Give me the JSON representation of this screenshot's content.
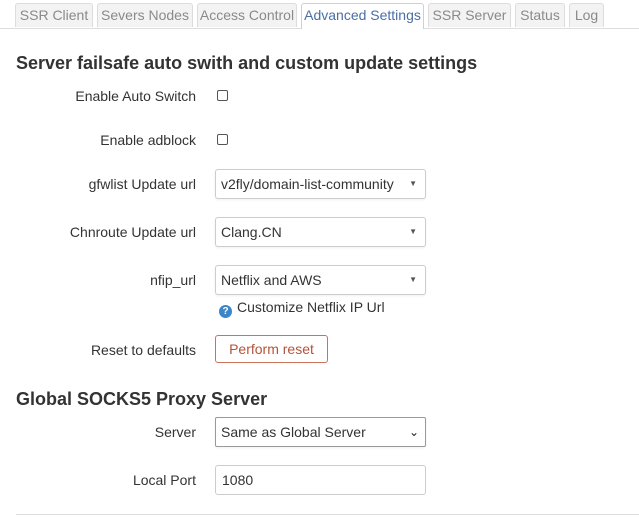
{
  "tabs": [
    {
      "label": "SSR Client"
    },
    {
      "label": "Severs Nodes"
    },
    {
      "label": "Access Control"
    },
    {
      "label": "Advanced Settings",
      "active": true
    },
    {
      "label": "SSR Server"
    },
    {
      "label": "Status"
    },
    {
      "label": "Log"
    }
  ],
  "failsafe": {
    "title": "Server failsafe auto swith and custom update settings",
    "auto_switch_label": "Enable Auto Switch",
    "adblock_label": "Enable adblock",
    "gfwlist_label": "gfwlist Update url",
    "gfwlist_value": "v2fly/domain-list-community",
    "chnroute_label": "Chnroute Update url",
    "chnroute_value": "Clang.CN",
    "nfip_label": "nfip_url",
    "nfip_value": "Netflix and AWS",
    "nfip_help": "Customize Netflix IP Url",
    "reset_label": "Reset to defaults",
    "reset_button": "Perform reset"
  },
  "socks": {
    "title": "Global SOCKS5 Proxy Server",
    "server_label": "Server",
    "server_value": "Same as Global Server",
    "port_label": "Local Port",
    "port_value": "1080"
  },
  "icons": {
    "help": "help-icon",
    "dropdown": "chevron-down-icon"
  },
  "colors": {
    "active_tab": "#4a6fa5",
    "reset_button": "#b5533a",
    "help_icon": "#3a86c8"
  }
}
